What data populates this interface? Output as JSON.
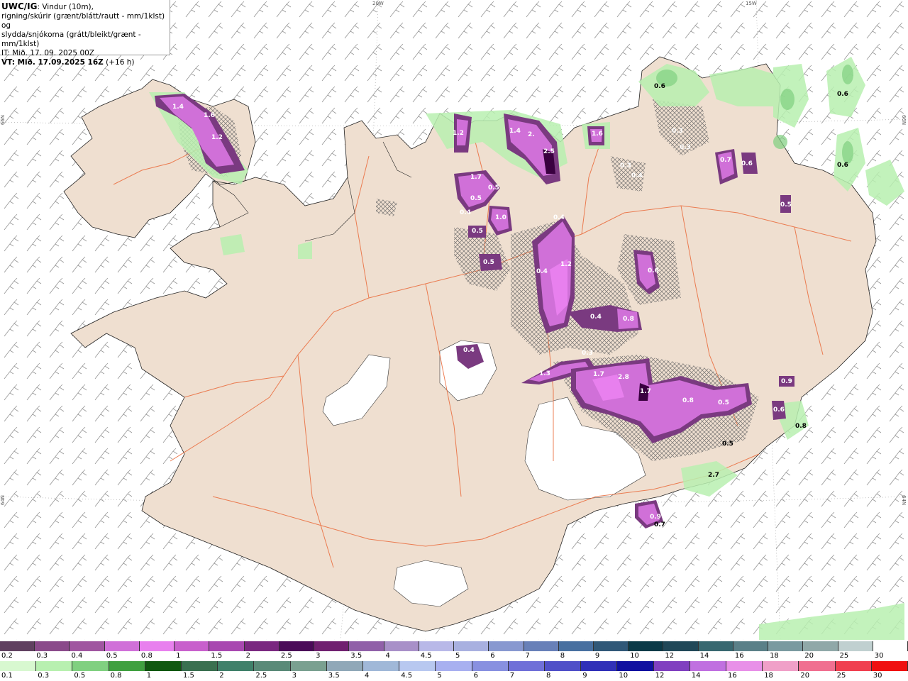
{
  "header": {
    "title": "UWC/IG",
    "title_suffix": ": Vindur (10m),",
    "line2": "rigning/skúrir (grænt/blátt/rautt - mm/1klst) og",
    "line3": "slydda/snjókoma (grátt/bleikt/grænt - mm/1klst)",
    "it": "IT: Mið. 17. 09. 2025 00Z",
    "vt": "VT: Mið. 17.09.2025 16Z",
    "vt_suffix": " (+16 h)"
  },
  "graticule": {
    "top_20w": "20W",
    "top_15w": "15W",
    "left_66n": "66N",
    "right_66n": "66N",
    "left_64n": "64N",
    "right_64n": "64N"
  },
  "precip_labels": [
    "1.4",
    "1.6",
    "1.2",
    "1.2",
    "1.4",
    "2.",
    "2.5",
    "1.6",
    "1.7",
    "0.5",
    "0.5",
    "0.4",
    "1.0",
    "0.5",
    "0.5",
    "0.4",
    "1.2",
    "0.4",
    "0.8",
    "0.4",
    "0.6",
    "0.4",
    "0.3",
    "0.7",
    "0.6",
    "0.5",
    "0.6",
    "0.3",
    "1.3",
    "1.7",
    "2.8",
    "1.7",
    "0.8",
    "0.5",
    "0.9",
    "0.6",
    "0.8",
    "2.7",
    "0.9",
    "0.7",
    "0.6",
    "0.6",
    "0.3",
    "0.4",
    "0.3",
    "0.5"
  ],
  "snow_scale": {
    "labels": [
      "0.2",
      "0.3",
      "0.4",
      "0.5",
      "0.8",
      "1",
      "1.5",
      "2",
      "2.5",
      "3",
      "3.5",
      "4",
      "4.5",
      "5",
      "6",
      "7",
      "8",
      "9",
      "10",
      "12",
      "14",
      "16",
      "18",
      "20",
      "25",
      "30"
    ],
    "colors": [
      "#604060",
      "#8a4a8a",
      "#a055a0",
      "#d070d8",
      "#e880ee",
      "#c860cc",
      "#a848b0",
      "#7a2880",
      "#4a0a58",
      "#702070",
      "#9060a8",
      "#a890c8",
      "#b8b8e8",
      "#a8b0e0",
      "#8898d0",
      "#6880b8",
      "#4870a0",
      "#305878",
      "#0a3a48",
      "#204858",
      "#386870",
      "#5a8088",
      "#7a9aa0",
      "#90a8a8",
      "#c0d0d0",
      "#ffffff"
    ]
  },
  "rain_scale": {
    "labels": [
      "0.1",
      "0.3",
      "0.5",
      "0.8",
      "1",
      "1.5",
      "2",
      "2.5",
      "3",
      "3.5",
      "4",
      "4.5",
      "5",
      "6",
      "7",
      "8",
      "9",
      "10",
      "12",
      "14",
      "16",
      "18",
      "20",
      "25",
      "30"
    ],
    "colors": [
      "#d8f8d0",
      "#b8f0b0",
      "#80d080",
      "#40a040",
      "#105810",
      "#3a7050",
      "#40806a",
      "#5a8a78",
      "#7aa090",
      "#90a8b8",
      "#a0b8d8",
      "#b8c8f0",
      "#a8b0f0",
      "#8890e0",
      "#7070d8",
      "#5050c8",
      "#3030b8",
      "#1010a0",
      "#8040c0",
      "#c070e0",
      "#e890e8",
      "#f0a0c8",
      "#f07090",
      "#f04050",
      "#f01010"
    ]
  }
}
